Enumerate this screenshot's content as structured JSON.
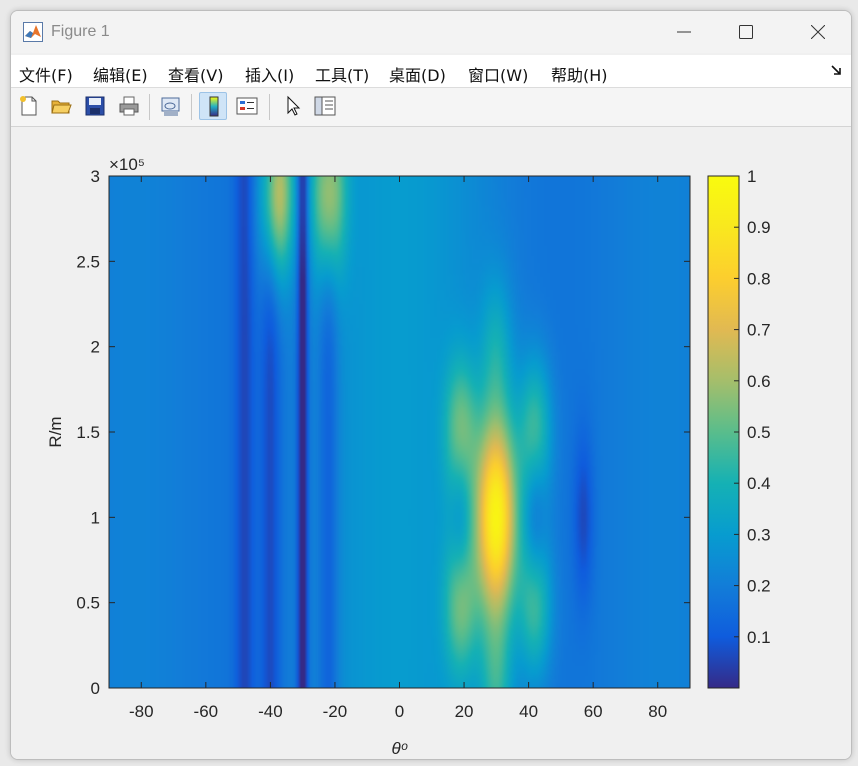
{
  "window": {
    "title": "Figure 1",
    "icon": "matlab-icon",
    "controls": [
      "minimize-icon",
      "maximize-icon",
      "close-icon"
    ]
  },
  "menu": {
    "items": [
      "文件(F)",
      "编辑(E)",
      "查看(V)",
      "插入(I)",
      "工具(T)",
      "桌面(D)",
      "窗口(W)",
      "帮助(H)"
    ],
    "dock_icon": "dock-arrow-icon"
  },
  "toolbar": {
    "icons": [
      "new-figure-icon",
      "open-file-icon",
      "save-icon",
      "print-icon",
      "link-figure-icon",
      "insert-colorbar-icon",
      "insert-legend-icon",
      "edit-plot-cursor-icon",
      "property-inspector-icon"
    ],
    "active": "insert-colorbar-icon"
  },
  "chart_data": {
    "type": "heatmap",
    "title": "",
    "xlabel": "θᵒ",
    "ylabel": "R/m",
    "xlim": [
      -90,
      90
    ],
    "ylim": [
      0,
      300000
    ],
    "xticks": [
      -80,
      -60,
      -40,
      -20,
      0,
      20,
      40,
      60,
      80
    ],
    "yticks": [
      0,
      0.5,
      1,
      1.5,
      2,
      2.5,
      3
    ],
    "y_exponent_label": "×10⁵",
    "colormap": "parula",
    "colorbar": {
      "range": [
        0,
        1
      ],
      "ticks": [
        0.1,
        0.2,
        0.3,
        0.4,
        0.5,
        0.6,
        0.7,
        0.8,
        0.9,
        1
      ],
      "position": "right"
    },
    "peak": {
      "theta_deg": 30,
      "R_m": 100000,
      "value": 1.0
    },
    "secondary_peaks": [
      {
        "theta_deg": 19,
        "R_m": 150000,
        "value": 0.55
      },
      {
        "theta_deg": 42,
        "R_m": 150000,
        "value": 0.55
      },
      {
        "theta_deg": 19,
        "R_m": 50000,
        "value": 0.55
      },
      {
        "theta_deg": 42,
        "R_m": 50000,
        "value": 0.55
      },
      {
        "theta_deg": 30,
        "R_m": 200000,
        "value": 0.4
      },
      {
        "theta_deg": 30,
        "R_m": 0,
        "value": 0.45
      },
      {
        "theta_deg": -38,
        "R_m": 290000,
        "value": 0.75
      },
      {
        "theta_deg": -22,
        "R_m": 290000,
        "value": 0.7
      }
    ],
    "nulls_theta_deg": [
      -30,
      -40,
      -48,
      -22,
      19,
      42,
      57
    ],
    "grid": false
  }
}
